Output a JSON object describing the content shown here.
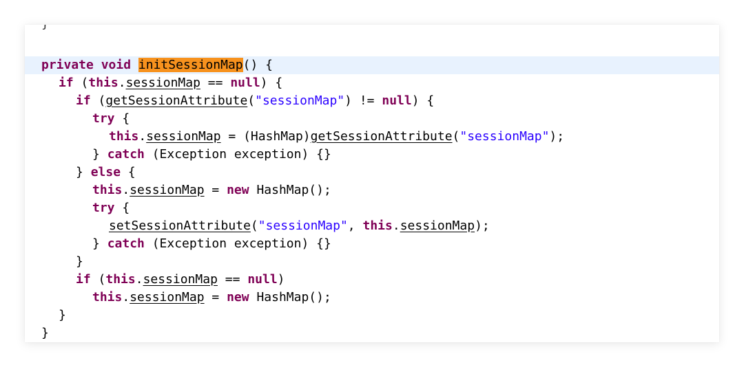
{
  "editor": {
    "lines": [
      {
        "indent": 0,
        "partial": true,
        "tokens": [
          {
            "t": "}",
            "c": "plain"
          }
        ]
      },
      {
        "indent": 0,
        "tokens": []
      },
      {
        "indent": 0,
        "active": true,
        "tokens": [
          {
            "t": "private",
            "c": "kw"
          },
          {
            "t": " ",
            "c": "plain"
          },
          {
            "t": "void",
            "c": "kw"
          },
          {
            "t": " ",
            "c": "plain"
          },
          {
            "t": "initSessionMap",
            "c": "hl"
          },
          {
            "t": "() {",
            "c": "plain"
          }
        ]
      },
      {
        "indent": 1,
        "tokens": [
          {
            "t": "if",
            "c": "kw"
          },
          {
            "t": " (",
            "c": "plain"
          },
          {
            "t": "this",
            "c": "kw"
          },
          {
            "t": ".",
            "c": "plain"
          },
          {
            "t": "sessionMap",
            "c": "under"
          },
          {
            "t": " == ",
            "c": "plain"
          },
          {
            "t": "null",
            "c": "kw"
          },
          {
            "t": ") {",
            "c": "plain"
          }
        ]
      },
      {
        "indent": 2,
        "tokens": [
          {
            "t": "if",
            "c": "kw"
          },
          {
            "t": " (",
            "c": "plain"
          },
          {
            "t": "getSessionAttribute",
            "c": "under"
          },
          {
            "t": "(",
            "c": "plain"
          },
          {
            "t": "\"sessionMap\"",
            "c": "str"
          },
          {
            "t": ") != ",
            "c": "plain"
          },
          {
            "t": "null",
            "c": "kw"
          },
          {
            "t": ") {",
            "c": "plain"
          }
        ]
      },
      {
        "indent": 3,
        "tokens": [
          {
            "t": "try",
            "c": "kw"
          },
          {
            "t": " {",
            "c": "plain"
          }
        ]
      },
      {
        "indent": 4,
        "tokens": [
          {
            "t": "this",
            "c": "kw"
          },
          {
            "t": ".",
            "c": "plain"
          },
          {
            "t": "sessionMap",
            "c": "under"
          },
          {
            "t": " = (HashMap)",
            "c": "plain"
          },
          {
            "t": "getSessionAttribute",
            "c": "under"
          },
          {
            "t": "(",
            "c": "plain"
          },
          {
            "t": "\"sessionMap\"",
            "c": "str"
          },
          {
            "t": ");",
            "c": "plain"
          }
        ]
      },
      {
        "indent": 3,
        "tokens": [
          {
            "t": "} ",
            "c": "plain"
          },
          {
            "t": "catch",
            "c": "kw"
          },
          {
            "t": " (Exception exception) {}",
            "c": "plain"
          }
        ]
      },
      {
        "indent": 2,
        "tokens": [
          {
            "t": "} ",
            "c": "plain"
          },
          {
            "t": "else",
            "c": "kw"
          },
          {
            "t": " {",
            "c": "plain"
          }
        ]
      },
      {
        "indent": 3,
        "tokens": [
          {
            "t": "this",
            "c": "kw"
          },
          {
            "t": ".",
            "c": "plain"
          },
          {
            "t": "sessionMap",
            "c": "under"
          },
          {
            "t": " = ",
            "c": "plain"
          },
          {
            "t": "new",
            "c": "kw"
          },
          {
            "t": " HashMap();",
            "c": "plain"
          }
        ]
      },
      {
        "indent": 3,
        "tokens": [
          {
            "t": "try",
            "c": "kw"
          },
          {
            "t": " {",
            "c": "plain"
          }
        ]
      },
      {
        "indent": 4,
        "tokens": [
          {
            "t": "setSessionAttribute",
            "c": "under"
          },
          {
            "t": "(",
            "c": "plain"
          },
          {
            "t": "\"sessionMap\"",
            "c": "str"
          },
          {
            "t": ", ",
            "c": "plain"
          },
          {
            "t": "this",
            "c": "kw"
          },
          {
            "t": ".",
            "c": "plain"
          },
          {
            "t": "sessionMap",
            "c": "under"
          },
          {
            "t": ");",
            "c": "plain"
          }
        ]
      },
      {
        "indent": 3,
        "tokens": [
          {
            "t": "} ",
            "c": "plain"
          },
          {
            "t": "catch",
            "c": "kw"
          },
          {
            "t": " (Exception exception) {}",
            "c": "plain"
          }
        ]
      },
      {
        "indent": 2,
        "tokens": [
          {
            "t": "}",
            "c": "plain"
          }
        ]
      },
      {
        "indent": 2,
        "tokens": [
          {
            "t": "if",
            "c": "kw"
          },
          {
            "t": " (",
            "c": "plain"
          },
          {
            "t": "this",
            "c": "kw"
          },
          {
            "t": ".",
            "c": "plain"
          },
          {
            "t": "sessionMap",
            "c": "under"
          },
          {
            "t": " == ",
            "c": "plain"
          },
          {
            "t": "null",
            "c": "kw"
          },
          {
            "t": ")",
            "c": "plain"
          }
        ]
      },
      {
        "indent": 3,
        "tokens": [
          {
            "t": "this",
            "c": "kw"
          },
          {
            "t": ".",
            "c": "plain"
          },
          {
            "t": "sessionMap",
            "c": "under"
          },
          {
            "t": " = ",
            "c": "plain"
          },
          {
            "t": "new",
            "c": "kw"
          },
          {
            "t": " HashMap();",
            "c": "plain"
          }
        ]
      },
      {
        "indent": 1,
        "tokens": [
          {
            "t": "}",
            "c": "plain"
          }
        ]
      },
      {
        "indent": 0,
        "tokens": [
          {
            "t": "}",
            "c": "plain"
          }
        ]
      }
    ]
  },
  "colors": {
    "keyword": "#7f0055",
    "string": "#2a00ff",
    "highlight": "#f7921e",
    "current_line": "#e8f2fe"
  }
}
